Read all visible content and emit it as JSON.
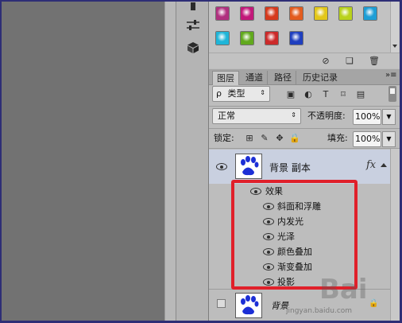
{
  "swatches": {
    "row1": [
      "#b0307f",
      "#c2187a",
      "#d63a1d",
      "#e35c1e",
      "#e3c71a",
      "#b9d21c",
      "#1d9ed6"
    ],
    "row2": [
      "#1fb5d8",
      "#61a91d",
      "#cc2a2a",
      "#1f3fbf"
    ]
  },
  "tabs": [
    {
      "label": "图层",
      "active": true
    },
    {
      "label": "通道",
      "active": false
    },
    {
      "label": "路径",
      "active": false
    },
    {
      "label": "历史记录",
      "active": false
    }
  ],
  "panel_menu_icon": "»≡",
  "filter": {
    "search_glyph": "ρ",
    "kind_label": "类型"
  },
  "blend": {
    "mode": "正常",
    "opacity_label": "不透明度:",
    "opacity_value": "100%"
  },
  "lock": {
    "label": "锁定:",
    "fill_label": "填充:",
    "fill_value": "100%"
  },
  "layers": {
    "top_layer": {
      "name": "背景 副本",
      "fx": "fx"
    },
    "effects_header": "效果",
    "effects": [
      "斜面和浮雕",
      "内发光",
      "光泽",
      "颜色叠加",
      "渐变叠加",
      "投影"
    ],
    "bottom_layer": {
      "name": "背景"
    }
  },
  "watermark": {
    "site": "jingyan.baidu.com",
    "logo": "Bai"
  },
  "colors": {
    "selected_layer": "#c9d0e0",
    "highlight": "#e0202a",
    "paw": "#1c2fd6"
  }
}
